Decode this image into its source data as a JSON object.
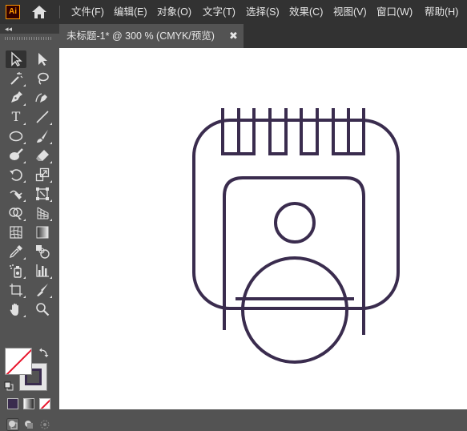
{
  "app": {
    "logo_text": "Ai"
  },
  "menu": {
    "items": [
      {
        "label": "文件(F)"
      },
      {
        "label": "编辑(E)"
      },
      {
        "label": "对象(O)"
      },
      {
        "label": "文字(T)"
      },
      {
        "label": "选择(S)"
      },
      {
        "label": "效果(C)"
      },
      {
        "label": "视图(V)"
      },
      {
        "label": "窗口(W)"
      },
      {
        "label": "帮助(H)"
      }
    ]
  },
  "document": {
    "tab_title": "未标题-1* @ 300 % (CMYK/预览)",
    "close_glyph": "✖"
  },
  "toolbar": {
    "collapse_glyph": "◂◂",
    "type_tool_glyph": "T",
    "tools": [
      "selection-tool",
      "direct-selection-tool",
      "magic-wand-tool",
      "lasso-tool",
      "pen-tool",
      "curvature-tool",
      "type-tool",
      "line-segment-tool",
      "ellipse-tool",
      "paintbrush-tool",
      "blob-brush-tool",
      "eraser-tool",
      "rotate-tool",
      "scale-tool",
      "warp-tool",
      "free-transform-tool",
      "shape-builder-tool",
      "perspective-grid-tool",
      "mesh-tool",
      "gradient-tool",
      "eyedropper-tool",
      "blend-tool",
      "symbol-sprayer-tool",
      "column-graph-tool",
      "artboard-tool",
      "slice-tool",
      "hand-tool",
      "zoom-tool"
    ],
    "fill_color": "#ffffff",
    "stroke_color": "#3a2c4e"
  },
  "colors": {
    "artwork_stroke": "#3a2c4e",
    "menubar_bg": "#323232",
    "panel_bg": "#535353",
    "accent_logo": "#ff9a00"
  }
}
